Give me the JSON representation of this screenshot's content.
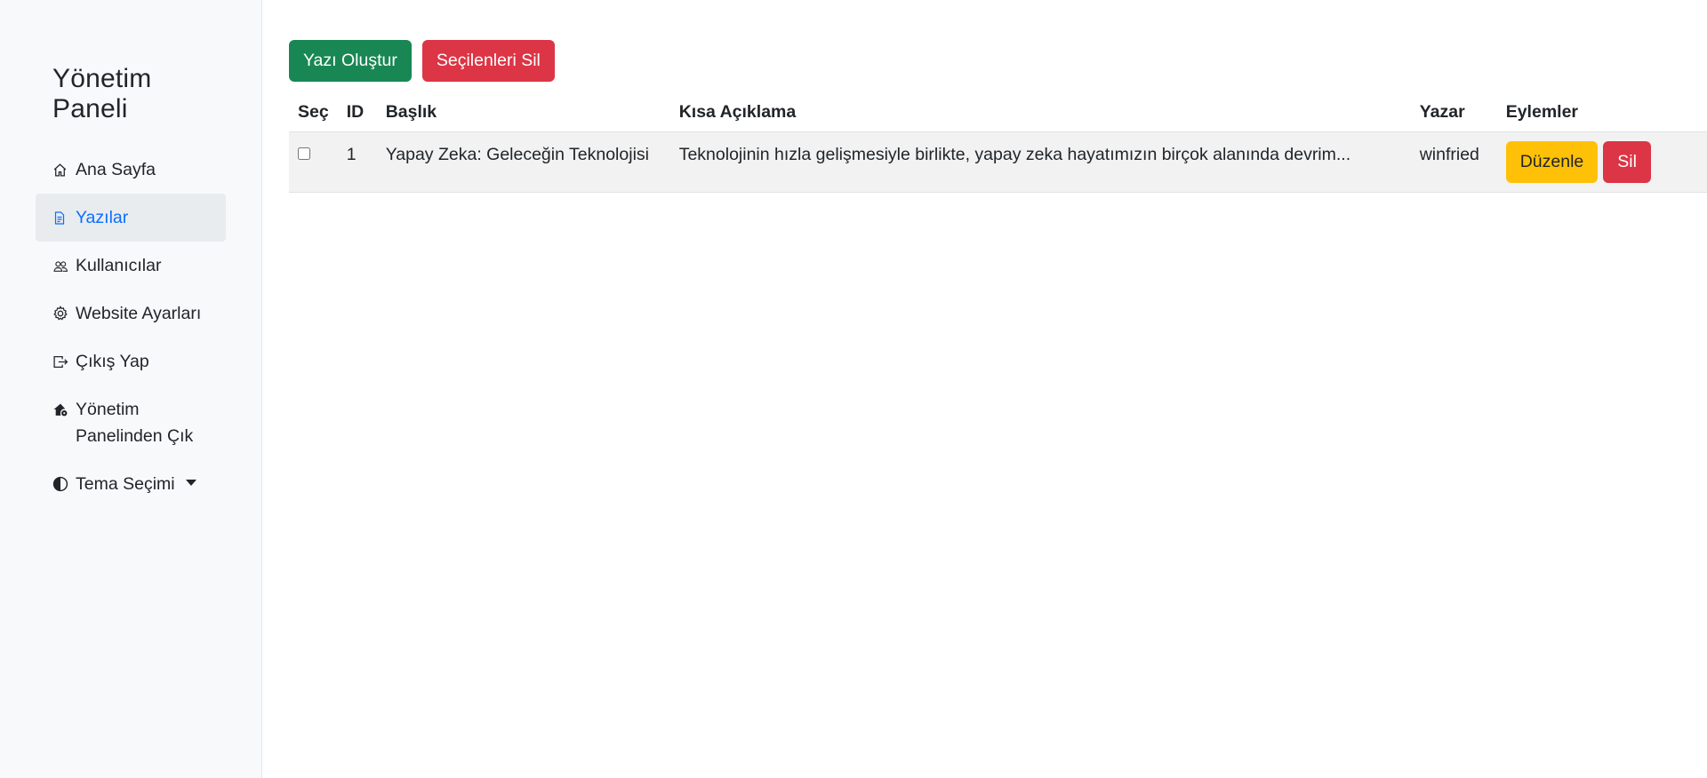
{
  "sidebar": {
    "title": "Yönetim Paneli",
    "items": [
      {
        "label": "Ana Sayfa",
        "icon": "house-icon",
        "active": false
      },
      {
        "label": "Yazılar",
        "icon": "file-text-icon",
        "active": true
      },
      {
        "label": "Kullanıcılar",
        "icon": "people-icon",
        "active": false
      },
      {
        "label": "Website Ayarları",
        "icon": "gear-icon",
        "active": false
      },
      {
        "label": "Çıkış Yap",
        "icon": "box-arrow-right-icon",
        "active": false
      },
      {
        "label": "Yönetim Panelinden Çık",
        "icon": "house-gear-icon",
        "active": false
      },
      {
        "label": "Tema Seçimi",
        "icon": "circle-half-icon",
        "active": false
      }
    ]
  },
  "toolbar": {
    "create_label": "Yazı Oluştur",
    "delete_selected_label": "Seçilenleri Sil"
  },
  "table": {
    "headers": [
      "Seç",
      "ID",
      "Başlık",
      "Kısa Açıklama",
      "Yazar",
      "Eylemler"
    ],
    "rows": [
      {
        "id": "1",
        "title": "Yapay Zeka: Geleceğin Teknolojisi",
        "summary": "Teknolojinin hızla gelişmesiyle birlikte, yapay zeka hayatımızın birçok alanında devrim...",
        "author": "winfried",
        "edit_label": "Düzenle",
        "delete_label": "Sil"
      }
    ]
  },
  "colors": {
    "primary": "#0d6efd",
    "success": "#198754",
    "danger": "#dc3545",
    "warning": "#ffc107"
  }
}
